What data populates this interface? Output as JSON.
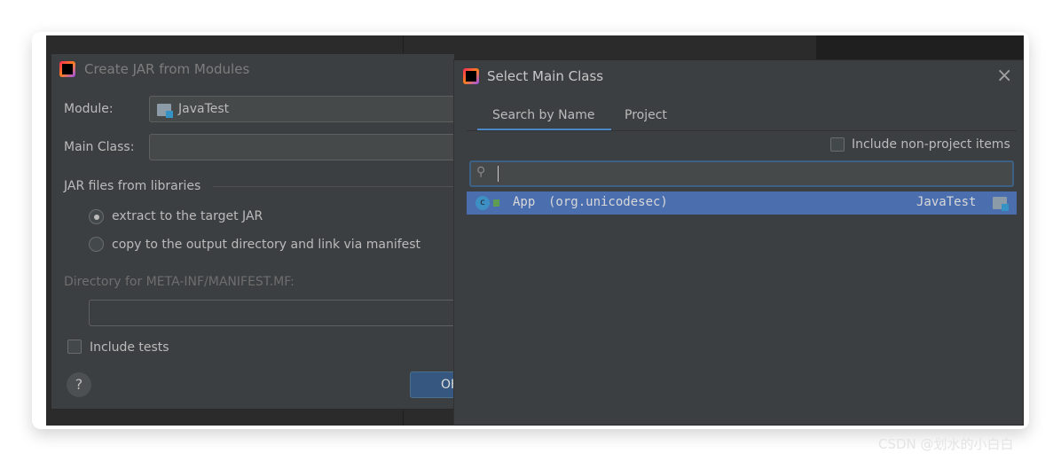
{
  "create_jar": {
    "title": "Create JAR from Modules",
    "module_label": "Module:",
    "module_value": "JavaTest",
    "main_class_label": "Main Class:",
    "main_class_value": "",
    "libraries_heading": "JAR files from libraries",
    "radio_extract": "extract to the target JAR",
    "radio_copy": "copy to the output directory and link via manifest",
    "selected_option": "extract to the target JAR",
    "manifest_label": "Directory for META-INF/MANIFEST.MF:",
    "manifest_value": "",
    "include_tests": "Include tests",
    "include_tests_checked": false,
    "help": "?",
    "ok": "OK"
  },
  "select_main_class": {
    "title": "Select Main Class",
    "close": "×",
    "tabs": [
      {
        "label": "Search by Name",
        "active": true
      },
      {
        "label": "Project",
        "active": false
      }
    ],
    "include_non_project": "Include non-project items",
    "include_non_project_checked": false,
    "search_value": "",
    "results": [
      {
        "name": "App",
        "package": "(org.unicodesec)",
        "module": "JavaTest",
        "selected": true
      }
    ]
  },
  "watermark": "CSDN @划水的小白白",
  "colors": {
    "accent": "#4a88c7",
    "selection": "#4b6eaf",
    "dialog_bg": "#3c3f41"
  }
}
